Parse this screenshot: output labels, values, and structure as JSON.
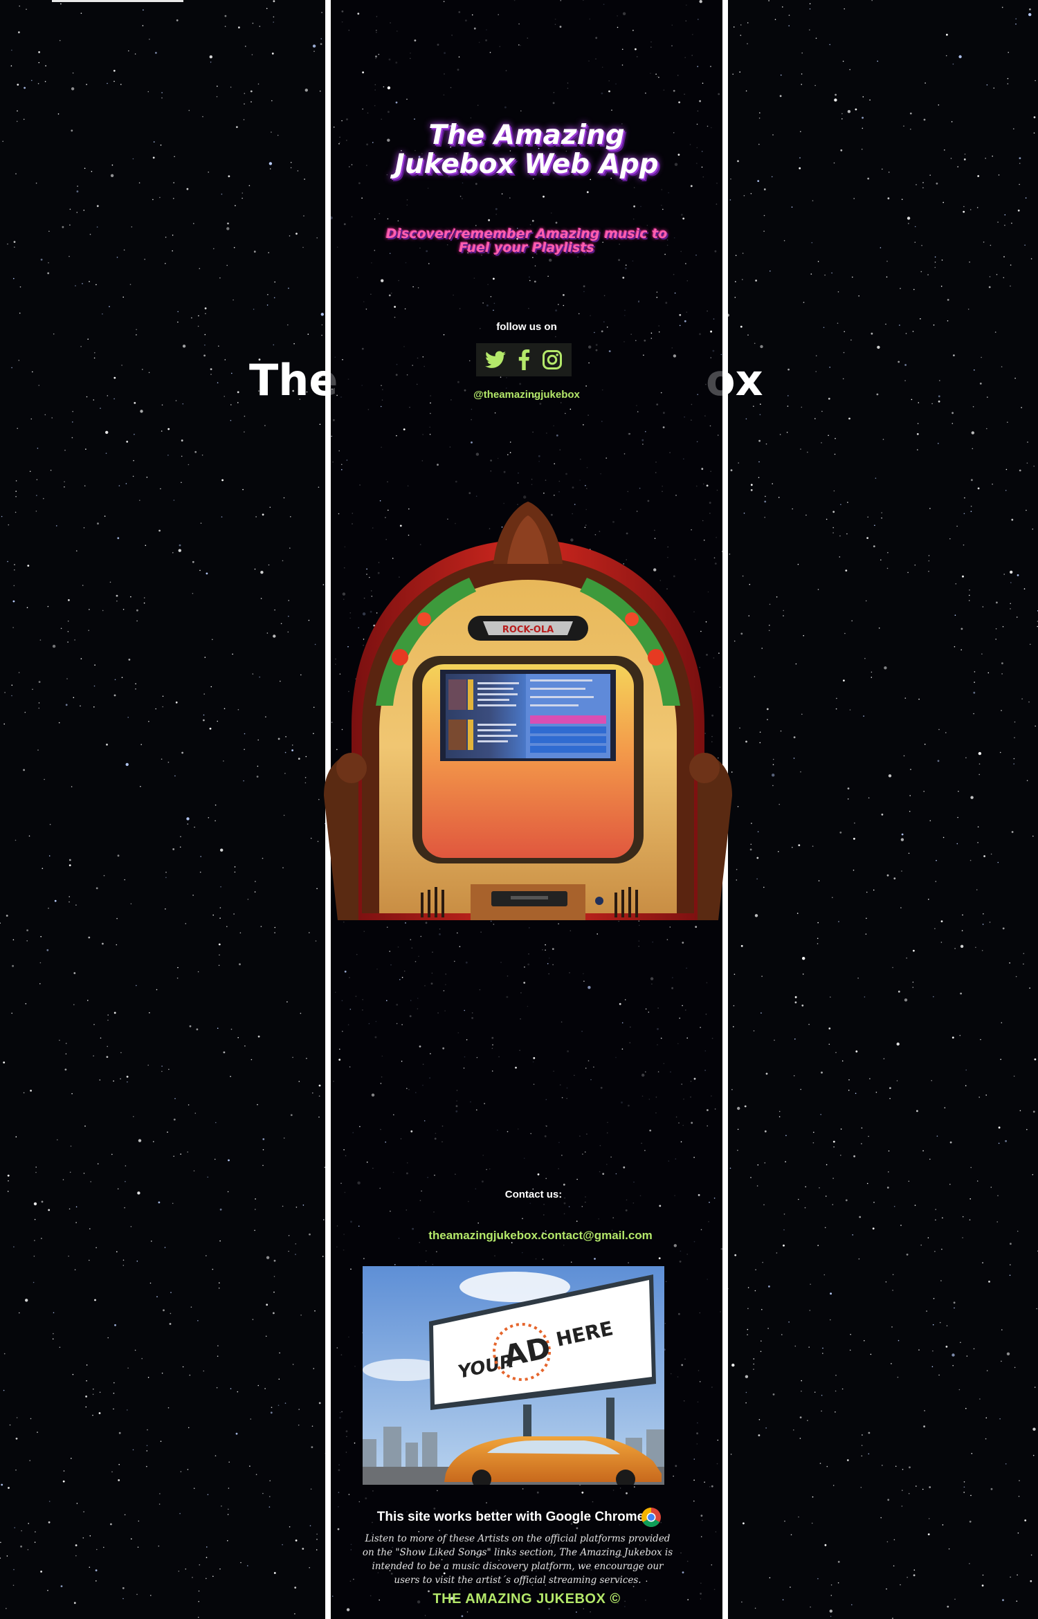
{
  "background_title": {
    "left": "The",
    "right": "ox"
  },
  "header": {
    "title": "The Amazing Jukebox Web App",
    "tagline": "Discover/remember Amazing music to Fuel your Playlists"
  },
  "social": {
    "follow_label": "follow us on",
    "icons": [
      "twitter-icon",
      "facebook-icon",
      "instagram-icon"
    ],
    "handle": "@theamazingjukebox",
    "icon_color": "#b4e86a"
  },
  "jukebox": {
    "brand": "ROCK-OLA"
  },
  "contact": {
    "label": "Contact us:",
    "email": "theamazingjukebox.contact@gmail.com"
  },
  "ad": {
    "line1": "YOUR",
    "line2": "AD",
    "line3": "HERE"
  },
  "footer": {
    "chrome_note": "This site works better with Google Chrome",
    "disclaimer": "Listen to more of these Artists on the official platforms provided on the \"Show Liked Songs\" links section, The Amazing Jukebox is intended to be a music discovery platform, we encourage our users to visit the artist´s official streaming services.",
    "copyright": "THE AMAZING JUKEBOX ©"
  },
  "colors": {
    "accent_green": "#b4e86a",
    "title_purple": "#9b3bd6",
    "tagline_pink": "#ff5fb0",
    "background": "#05060a"
  }
}
